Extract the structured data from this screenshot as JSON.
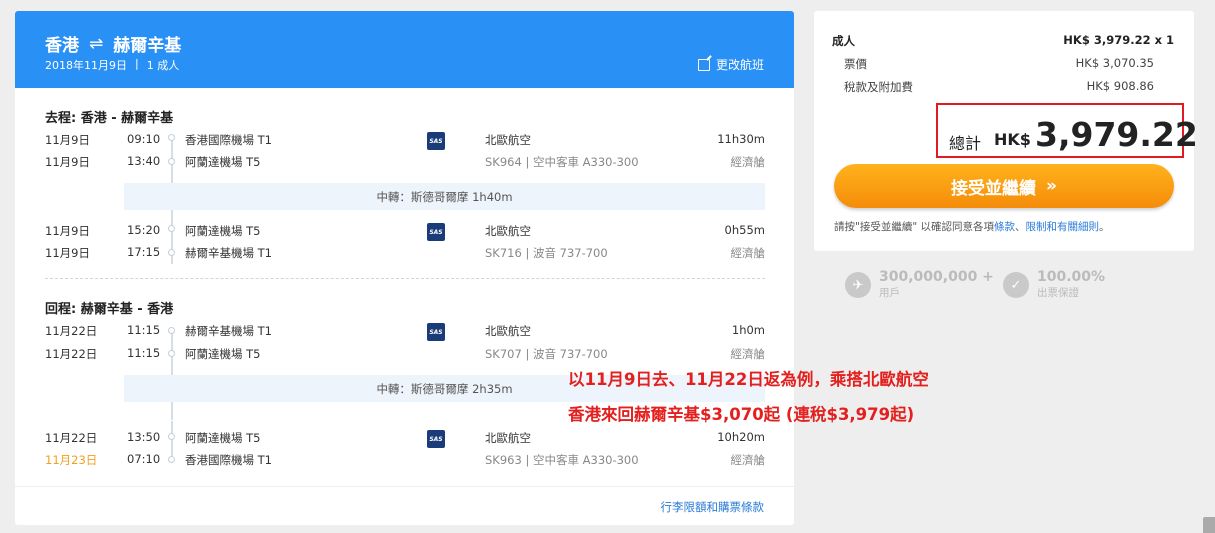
{
  "header": {
    "origin": "香港",
    "swap_icon": "⇌",
    "destination": "赫爾辛基",
    "date": "2018年11月9日",
    "separator": "|",
    "pax": "1 成人",
    "edit_label": "更改航班"
  },
  "outbound": {
    "title": "去程: 香港 - 赫爾辛基",
    "segments": [
      {
        "dep_date": "11月9日",
        "dep_time": "09:10",
        "dep_airport": "香港國際機場 T1",
        "arr_date": "11月9日",
        "arr_time": "13:40",
        "arr_airport": "阿蘭達機場 T5",
        "airline": "北歐航空",
        "flight": "SK964 | 空中客車 A330-300",
        "duration": "11h30m",
        "cabin": "經濟艙"
      },
      {
        "dep_date": "11月9日",
        "dep_time": "15:20",
        "dep_airport": "阿蘭達機場 T5",
        "arr_date": "11月9日",
        "arr_time": "17:15",
        "arr_airport": "赫爾辛基機場 T1",
        "airline": "北歐航空",
        "flight": "SK716 | 波音 737-700",
        "duration": "0h55m",
        "cabin": "經濟艙"
      }
    ],
    "transfer": "中轉：斯德哥爾摩 1h40m"
  },
  "inbound": {
    "title": "回程: 赫爾辛基 - 香港",
    "segments": [
      {
        "dep_date": "11月22日",
        "dep_time": "11:15",
        "dep_airport": "赫爾辛基機場 T1",
        "arr_date": "11月22日",
        "arr_time": "11:15",
        "arr_airport": "阿蘭達機場 T5",
        "airline": "北歐航空",
        "flight": "SK707 | 波音 737-700",
        "duration": "1h0m",
        "cabin": "經濟艙"
      },
      {
        "dep_date": "11月22日",
        "dep_time": "13:50",
        "dep_airport": "阿蘭達機場 T5",
        "arr_date": "11月23日",
        "arr_time": "07:10",
        "arr_airport": "香港國際機場 T1",
        "airline": "北歐航空",
        "flight": "SK963 | 空中客車 A330-300",
        "duration": "10h20m",
        "cabin": "經濟艙"
      }
    ],
    "transfer": "中轉：斯德哥爾摩 2h35m"
  },
  "airline_logo": "SAS",
  "baggage_link": "行李限額和購票條款",
  "price": {
    "adult_label": "成人",
    "adult_value": "HK$ 3,979.22 x 1",
    "fare_label": "票價",
    "fare_value": "HK$ 3,070.35",
    "tax_label": "稅款及附加費",
    "tax_value": "HK$ 908.86",
    "total_label": "總計",
    "total_currency": "HK$",
    "total_amount": "3,979.22",
    "accept_label": "接受並繼續",
    "accept_icon": "»",
    "terms_prefix": "請按\"接受並繼續\" 以確認同意各項",
    "terms_link1": "條款",
    "terms_sep": "、",
    "terms_link2": "限制和有關細則",
    "terms_suffix": "。"
  },
  "stats": [
    {
      "icon": "plane-icon",
      "glyph": "✈",
      "value": "300,000,000 +",
      "caption": "用戶"
    },
    {
      "icon": "shield-icon",
      "glyph": "✓",
      "value": "100.00%",
      "caption": "出票保證"
    }
  ],
  "annotation": {
    "line1": "以11月9日去、11月22日返為例，乘搭北歐航空",
    "line2": "香港來回赫爾辛基$3,070起 (連稅$3,979起)"
  },
  "colors": {
    "header_blue": "#2990f5",
    "accent_orange": "#f58c0a",
    "annot_red": "#e3201e",
    "link_blue": "#2a7ad8"
  }
}
